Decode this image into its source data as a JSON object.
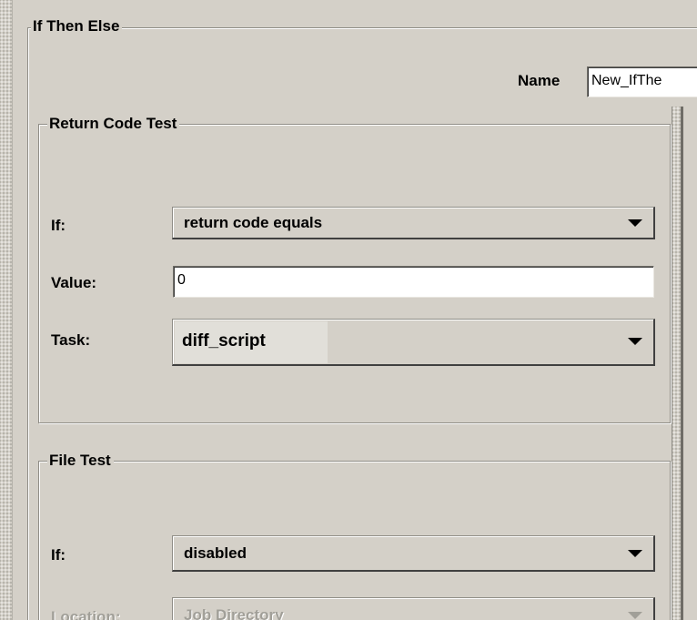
{
  "panel": {
    "title": "If Then Else",
    "name_label": "Name",
    "name_value": "New_IfThe"
  },
  "return_code_test": {
    "title": "Return Code Test",
    "if_label": "If:",
    "if_value": "return code equals",
    "value_label": "Value:",
    "value_value": "0",
    "task_label": "Task:",
    "task_value": "diff_script"
  },
  "file_test": {
    "title": "File Test",
    "if_label": "If:",
    "if_value": "disabled",
    "location_label": "Location:",
    "location_value": "Job Directory"
  },
  "icons": {
    "dropdown": "chevron-down-icon"
  },
  "colors": {
    "background": "#d4d0c8",
    "border_dark": "#8f8d86",
    "disabled_text": "#a19f98"
  }
}
